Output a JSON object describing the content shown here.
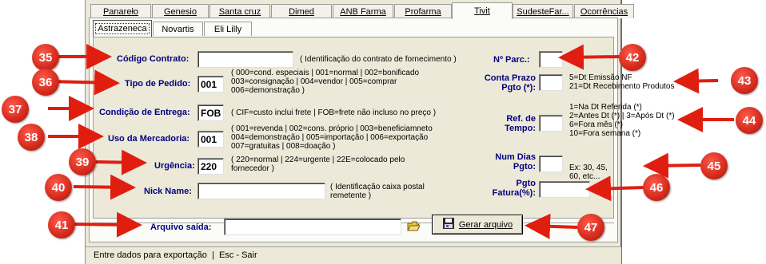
{
  "outer_tabs": [
    "Panareło",
    "Genesio",
    "Santa cruz",
    "Dimed",
    "ANB Farma",
    "Profarma",
    "Tivit",
    "SudesteFar...",
    "Ocorrências"
  ],
  "outer_active": "Tivit",
  "inner_tabs": [
    "Astrazeneca",
    "Novartis",
    "Eli Lilly"
  ],
  "inner_active": "Astrazeneca",
  "form": {
    "codigo_contrato": {
      "label": "Código Contrato:",
      "value": "",
      "hint": "( Identificação do contrato de fornecimento )"
    },
    "tipo_pedido": {
      "label": "Tipo de Pedido:",
      "value": "001",
      "hint": [
        "( 000=cond. especiais | 001=normal | 002=bonificado",
        "003=consignação | 004=vendor | 005=comprar",
        "006=demonstração )"
      ]
    },
    "condicao_entrega": {
      "label": "Condição de Entrega:",
      "value": "FOB",
      "hint": "( CIF=custo inclui frete | FOB=frete não incluso no preço )"
    },
    "uso_mercadoria": {
      "label": "Uso da Mercadoria:",
      "value": "001",
      "hint": [
        "( 001=revenda | 002=cons. próprio | 003=beneficiamneto",
        "004=demonstração | 005=importação | 006=exportação",
        "007=gratuitas | 008=doação )"
      ]
    },
    "urgencia": {
      "label": "Urgência:",
      "value": "220",
      "hint": [
        "( 220=normal | 224=urgente | 22E=colocado pelo",
        "fornecedor )"
      ]
    },
    "nick_name": {
      "label": "Nick Name:",
      "value": "",
      "hint": [
        "( Identificação caixa postal",
        "remetente )"
      ]
    },
    "num_parc": {
      "label": "Nº Parc.:",
      "value": ""
    },
    "conta_prazo": {
      "label_1": "Conta Prazo",
      "label_2": "Pgto (*):",
      "value": "",
      "hint": [
        "5=Dt Emissão NF",
        "21=Dt Recebimento Produtos"
      ]
    },
    "ref_tempo": {
      "label_1": "Ref. de",
      "label_2": "Tempo:",
      "value": "",
      "hint": [
        "1=Na Dt Referida (*)",
        "2=Antes Dt (*) | 3=Após Dt (*)",
        "6=Fora mês (*)",
        "10=Fora semana (*)"
      ]
    },
    "num_dias": {
      "label_1": "Num Dias",
      "label_2": "Pgto:",
      "value": "",
      "hint": "Ex: 30, 45, 60, etc..."
    },
    "pgto_fatura": {
      "label_1": "Pgto",
      "label_2": "Fatura(%):",
      "value": ""
    },
    "arquivo_saida": {
      "label": "Arquivo saída:",
      "value": ""
    },
    "gerar_button": "Gerar arquivo"
  },
  "status": "Entre dados para exportação  |  Esc - Sair",
  "markers": [
    "35",
    "36",
    "37",
    "38",
    "39",
    "40",
    "41",
    "42",
    "43",
    "44",
    "45",
    "46",
    "47"
  ],
  "colors": {
    "marker": "#d42a1c",
    "label": "#000080",
    "window": "#ece9d8"
  }
}
